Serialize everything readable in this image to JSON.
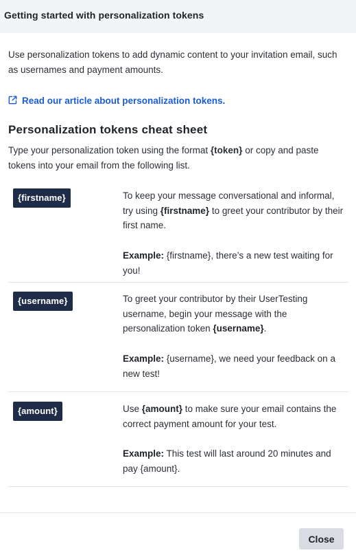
{
  "header": {
    "title": "Getting started with personalization tokens"
  },
  "intro": {
    "text": "Use personalization tokens to add dynamic content to your invitation email, such as usernames and payment amounts."
  },
  "article_link": {
    "icon": "external-link-icon",
    "label": "Read our article about personalization tokens."
  },
  "cheat_sheet": {
    "heading": "Personalization tokens cheat sheet",
    "desc_before": "Type your personalization token using the format ",
    "desc_token": "{token}",
    "desc_after": " or copy and paste tokens into your email from the following list."
  },
  "tokens": [
    {
      "badge": "{firstname}",
      "desc_before": "To keep your message conversational and informal, try using ",
      "desc_token": "{firstname}",
      "desc_after": " to greet your contributor by their first name.",
      "example_label": "Example:",
      "example_text": " {firstname}, there’s a new test waiting for you!"
    },
    {
      "badge": "{username}",
      "desc_before": "To greet your contributor by their UserTesting username, begin your message with the personalization token ",
      "desc_token": "{username}",
      "desc_after": ".",
      "example_label": "Example:",
      "example_text": " {username}, we need your feedback on a new test!"
    },
    {
      "badge": "{amount}",
      "desc_before": "Use ",
      "desc_token": "{amount}",
      "desc_after": " to make sure your email contains the correct payment amount for your test.",
      "example_label": "Example:",
      "example_text": " This test will last around 20 minutes and pay {amount}."
    }
  ],
  "footer": {
    "close_label": "Close"
  },
  "colors": {
    "header_bg": "#f3f4f7",
    "link": "#1a5cd6",
    "badge_bg": "#1e2c47",
    "button_bg": "#d9dce2"
  }
}
